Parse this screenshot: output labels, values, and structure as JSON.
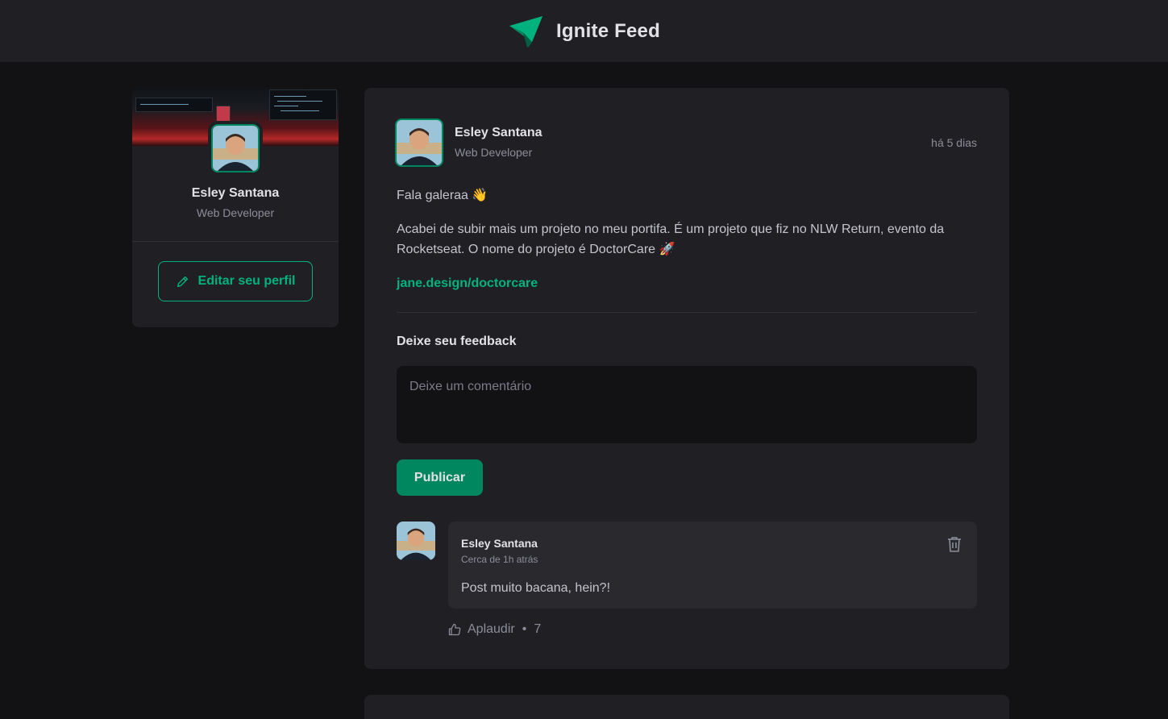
{
  "header": {
    "title": "Ignite Feed",
    "logo_icon": "paper-plane-logo-icon"
  },
  "sidebar": {
    "name": "Esley Santana",
    "role": "Web Developer",
    "edit_button_label": "Editar seu perfil",
    "edit_icon": "pencil-icon"
  },
  "post": {
    "author": "Esley Santana",
    "role": "Web Developer",
    "time": "há 5 dias",
    "paragraphs": [
      "Fala galeraa 👋",
      "Acabei de subir mais um projeto no meu portifa. É um projeto que fiz no NLW Return, evento da Rocketseat. O nome do projeto é DoctorCare 🚀"
    ],
    "link": "jane.design/doctorcare",
    "feedback_title": "Deixe seu feedback",
    "comment_placeholder": "Deixe um comentário",
    "publish_label": "Publicar"
  },
  "comment": {
    "author": "Esley Santana",
    "time": "Cerca de 1h atrás",
    "text": "Post muito bacana, hein?!",
    "applaud_label": "Aplaudir",
    "applaud_separator": "•",
    "applaud_count": "7",
    "trash_icon": "trash-icon",
    "thumbs_icon": "thumbs-up-icon"
  },
  "colors": {
    "background": "#121214",
    "card": "#202024",
    "accent": "#00b37e",
    "button": "#00875f"
  }
}
